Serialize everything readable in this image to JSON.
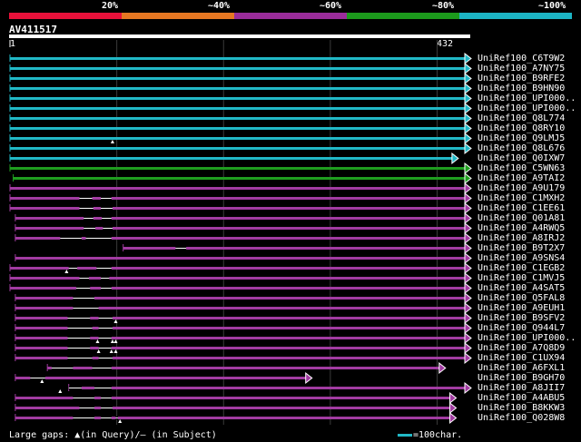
{
  "scale": {
    "labels": [
      "20%",
      "~40%",
      "~60%",
      "~80%",
      "~100%"
    ],
    "colors": [
      "#e8113a",
      "#e67722",
      "#9a2c9a",
      "#1c9a1c",
      "#1cb4c4"
    ]
  },
  "query": {
    "name": "AV411517",
    "start": "1",
    "end": "432"
  },
  "colors": {
    "cyan": "#21b8c6",
    "green": "#1f9d1f",
    "purple": "#a13ba1",
    "gap": "#ffffff",
    "grid": "#3a3a3a"
  },
  "hits": [
    {
      "name": "UniRef100_C6T9W2",
      "color": "cyan",
      "start": 1,
      "end": 432,
      "gaps": []
    },
    {
      "name": "UniRef100_A7NY75",
      "color": "cyan",
      "start": 1,
      "end": 432,
      "gaps": []
    },
    {
      "name": "UniRef100_B9RFE2",
      "color": "cyan",
      "start": 1,
      "end": 432,
      "gaps": []
    },
    {
      "name": "UniRef100_B9HN90",
      "color": "cyan",
      "start": 1,
      "end": 432,
      "gaps": []
    },
    {
      "name": "UniRef100_UPI000..",
      "color": "cyan",
      "start": 1,
      "end": 432,
      "gaps": []
    },
    {
      "name": "UniRef100_UPI000..",
      "color": "cyan",
      "start": 1,
      "end": 432,
      "gaps": []
    },
    {
      "name": "UniRef100_Q8L774",
      "color": "cyan",
      "start": 1,
      "end": 432,
      "gaps": []
    },
    {
      "name": "UniRef100_Q8RY10",
      "color": "cyan",
      "start": 1,
      "end": 432,
      "gaps": []
    },
    {
      "name": "UniRef100_Q9LMJ5",
      "color": "cyan",
      "start": 1,
      "end": 432,
      "gaps": [],
      "tri": [
        97
      ]
    },
    {
      "name": "UniRef100_Q8L676",
      "color": "cyan",
      "start": 1,
      "end": 432,
      "gaps": []
    },
    {
      "name": "UniRef100_Q0IXW7",
      "color": "cyan",
      "start": 1,
      "end": 420,
      "gaps": []
    },
    {
      "name": "UniRef100_C5WN63",
      "color": "green",
      "start": 1,
      "end": 432,
      "gaps": []
    },
    {
      "name": "UniRef100_A9TAI2",
      "color": "green",
      "start": 4,
      "end": 432,
      "gaps": []
    },
    {
      "name": "UniRef100_A9U179",
      "color": "purple",
      "start": 1,
      "end": 432,
      "gaps": []
    },
    {
      "name": "UniRef100_C1MXH2",
      "color": "purple",
      "start": 1,
      "end": 432,
      "gaps": [
        [
          66,
          78
        ],
        [
          86,
          96
        ]
      ]
    },
    {
      "name": "UniRef100_C1EE61",
      "color": "purple",
      "start": 1,
      "end": 432,
      "gaps": [
        [
          66,
          79
        ],
        [
          86,
          97
        ]
      ]
    },
    {
      "name": "UniRef100_Q01A81",
      "color": "purple",
      "start": 6,
      "end": 432,
      "gaps": [
        [
          70,
          79
        ],
        [
          87,
          96
        ]
      ]
    },
    {
      "name": "UniRef100_A4RWQ5",
      "color": "purple",
      "start": 6,
      "end": 432,
      "gaps": [
        [
          70,
          81
        ],
        [
          88,
          97
        ]
      ]
    },
    {
      "name": "UniRef100_A8IRJ2",
      "color": "purple",
      "start": 6,
      "end": 432,
      "gaps": [
        [
          48,
          68
        ],
        [
          72,
          96
        ]
      ]
    },
    {
      "name": "UniRef100_B9T2X7",
      "color": "purple",
      "start": 107,
      "end": 432,
      "gaps": [
        [
          156,
          166
        ]
      ]
    },
    {
      "name": "UniRef100_A9SNS4",
      "color": "purple",
      "start": 6,
      "end": 432,
      "gaps": []
    },
    {
      "name": "UniRef100_C1EGB2",
      "color": "purple",
      "start": 1,
      "end": 432,
      "gaps": [
        [
          56,
          64
        ],
        [
          82,
          96
        ]
      ],
      "tri": [
        54
      ]
    },
    {
      "name": "UniRef100_C1MVJ5",
      "color": "purple",
      "start": 1,
      "end": 432,
      "gaps": [
        [
          66,
          75
        ],
        [
          86,
          94
        ]
      ]
    },
    {
      "name": "UniRef100_A4SAT5",
      "color": "purple",
      "start": 1,
      "end": 432,
      "gaps": [
        [
          63,
          76
        ],
        [
          86,
          96
        ]
      ]
    },
    {
      "name": "UniRef100_Q5FAL8",
      "color": "purple",
      "start": 6,
      "end": 432,
      "gaps": [
        [
          60,
          80
        ]
      ]
    },
    {
      "name": "UniRef100_A9EUH1",
      "color": "purple",
      "start": 6,
      "end": 432,
      "gaps": [
        [
          60,
          84
        ]
      ]
    },
    {
      "name": "UniRef100_B9SFV2",
      "color": "purple",
      "start": 6,
      "end": 432,
      "gaps": [
        [
          55,
          76
        ],
        [
          84,
          97
        ]
      ],
      "tri": [
        100
      ]
    },
    {
      "name": "UniRef100_Q944L7",
      "color": "purple",
      "start": 6,
      "end": 432,
      "gaps": [
        [
          55,
          78
        ],
        [
          84,
          97
        ]
      ]
    },
    {
      "name": "UniRef100_UPI000..",
      "color": "purple",
      "start": 6,
      "end": 432,
      "gaps": [
        [
          55,
          76
        ],
        [
          84,
          96
        ]
      ],
      "tri": [
        83,
        97,
        100
      ]
    },
    {
      "name": "UniRef100_A7Q8D9",
      "color": "purple",
      "start": 6,
      "end": 432,
      "gaps": [
        [
          55,
          76
        ],
        [
          84,
          96
        ]
      ],
      "tri": [
        84,
        96,
        100
      ]
    },
    {
      "name": "UniRef100_C1UX94",
      "color": "purple",
      "start": 6,
      "end": 432,
      "gaps": [
        [
          55,
          78
        ],
        [
          84,
          97
        ]
      ]
    },
    {
      "name": "UniRef100_A6FXL1",
      "color": "purple",
      "start": 36,
      "end": 408,
      "gaps": [
        [
          40,
          60
        ],
        [
          78,
          96
        ]
      ]
    },
    {
      "name": "UniRef100_B9GH70",
      "color": "purple",
      "start": 6,
      "end": 283,
      "gaps": [
        [
          20,
          34
        ]
      ],
      "tri": [
        31
      ]
    },
    {
      "name": "UniRef100_A8JII7",
      "color": "purple",
      "start": 56,
      "end": 432,
      "gaps": [
        [
          56,
          68
        ],
        [
          80,
          96
        ]
      ],
      "tri": [
        48
      ]
    },
    {
      "name": "UniRef100_A4ABU5",
      "color": "purple",
      "start": 6,
      "end": 418,
      "gaps": [
        [
          60,
          80
        ],
        [
          86,
          96
        ]
      ]
    },
    {
      "name": "UniRef100_B8KKW3",
      "color": "purple",
      "start": 6,
      "end": 418,
      "gaps": [
        [
          66,
          80
        ],
        [
          86,
          97
        ]
      ]
    },
    {
      "name": "UniRef100_Q028W8",
      "color": "purple",
      "start": 6,
      "end": 418,
      "gaps": [
        [
          60,
          80
        ],
        [
          86,
          96
        ],
        [
          100,
          102
        ]
      ],
      "tri": [
        104
      ]
    }
  ],
  "footer": {
    "legend": "Large gaps: ▲(in Query)/– (in Subject)",
    "scale_note": "=100char."
  }
}
